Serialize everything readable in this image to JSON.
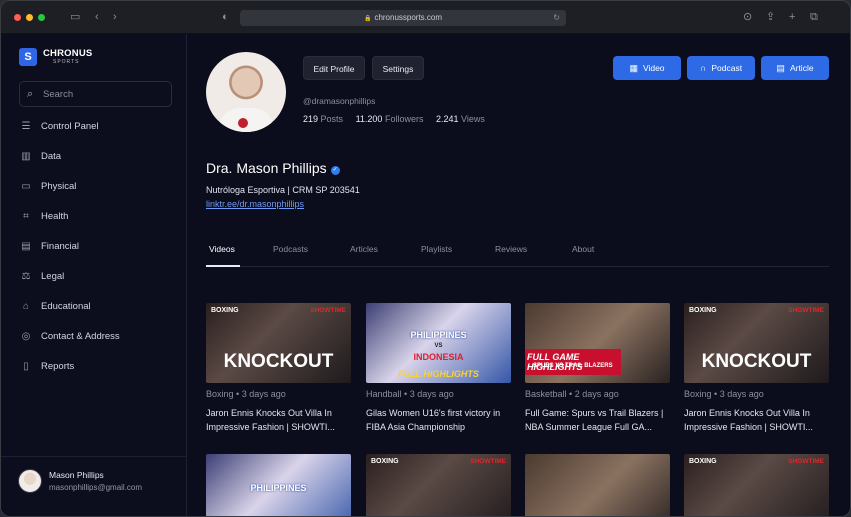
{
  "browser": {
    "url": "chronussports.com"
  },
  "sidebar": {
    "brand": "CHRONUS",
    "brand_sub": "SPORTS",
    "search_placeholder": "Search",
    "items": [
      {
        "label": "Control Panel",
        "icon": "sliders-icon"
      },
      {
        "label": "Data",
        "icon": "bar-chart-icon"
      },
      {
        "label": "Physical",
        "icon": "monitor-icon"
      },
      {
        "label": "Health",
        "icon": "scan-icon"
      },
      {
        "label": "Financial",
        "icon": "wallet-icon"
      },
      {
        "label": "Legal",
        "icon": "gavel-icon"
      },
      {
        "label": "Educational",
        "icon": "graduation-cap-icon"
      },
      {
        "label": "Contact & Address",
        "icon": "map-pin-icon"
      },
      {
        "label": "Reports",
        "icon": "clipboard-icon"
      }
    ],
    "user": {
      "name": "Mason Phillips",
      "email": "masonphillips@gmail.com"
    }
  },
  "profile": {
    "edit_label": "Edit Profile",
    "settings_label": "Settings",
    "handle": "@dramasonphillips",
    "posts_count": "219",
    "posts_label": "Posts",
    "followers_count": "11.200",
    "followers_label": "Followers",
    "views_count": "2.241",
    "views_label": "Views",
    "name": "Dra. Mason Phillips",
    "bio": "Nutróloga Esportiva | CRM SP 203541",
    "link": "linktr.ee/dr.masonphillips"
  },
  "actions": {
    "video": "Video",
    "podcast": "Podcast",
    "article": "Article"
  },
  "tabs": [
    "Videos",
    "Podcasts",
    "Articles",
    "Playlists",
    "Reviews",
    "About"
  ],
  "videos": [
    {
      "category": "Boxing",
      "age": "3 days ago",
      "title": "Jaron Ennis Knocks Out Villa In Impressive Fashion | SHOWTI...",
      "brand": "BOXING",
      "brand2": "SHOWTIME",
      "overlay": "KNOCKOUT"
    },
    {
      "category": "Handball",
      "age": "3 days ago",
      "title": "Gilas Women U16's first victory in FIBA Asia Championship",
      "top": "PHILIPPINES",
      "vs": "VS",
      "bottom": "INDONESIA",
      "overlay": "FULL HIGHLIGHTS"
    },
    {
      "category": "Basketball",
      "age": "2 days ago",
      "title": "Full Game: Spurs vs Trail Blazers | NBA Summer League Full GA...",
      "overlay": "FULL GAME HIGHLIGHTS",
      "sub": "SPURS VS TRAIL BLAZERS"
    },
    {
      "category": "Boxing",
      "age": "3 days ago",
      "title": "Jaron Ennis Knocks Out Villa In Impressive Fashion | SHOWTI...",
      "brand": "BOXING",
      "brand2": "SHOWTIME",
      "overlay": "KNOCKOUT"
    }
  ],
  "videos_row2": [
    {
      "top": "PHILIPPINES"
    },
    {
      "brand": "BOXING",
      "brand2": "SHOWTIME"
    },
    {},
    {
      "brand": "BOXING",
      "brand2": "SHOWTIME"
    }
  ]
}
